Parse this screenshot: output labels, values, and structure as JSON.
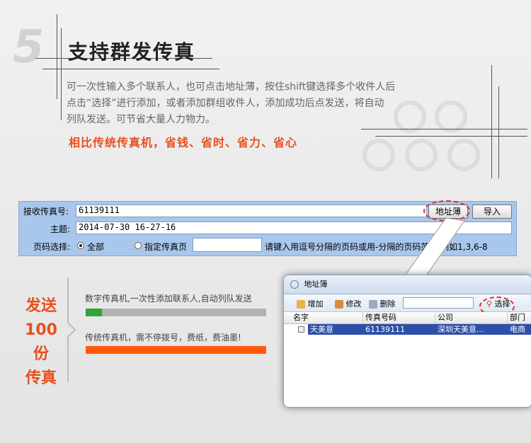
{
  "header": {
    "step_number": "5",
    "title": "支持群发传真",
    "desc_line1": "可一次性输入多个联系人，也可点击地址薄，按住shift键选择多个收件人后",
    "desc_line2": "点击“选择”进行添加，或者添加群组收件人，添加成功后点发送，将自动",
    "desc_line3": "列队发送。可节省大量人力物力。",
    "slogan": "相比传统传真机，省钱、省时、省力、省心"
  },
  "fax_form": {
    "fax_number_label": "接收传真号:",
    "fax_number_value": "61139111",
    "address_book_button": "地址薄",
    "import_button": "导入",
    "subject_label": "主题:",
    "subject_value": "2014-07-30 16-27-16",
    "page_select_label": "页码选择:",
    "option_all": "全部",
    "option_specified": "指定传真页",
    "hint": "请键入用逗号分隔的页码或用-分隔的页码范围,例如1,3,6-8"
  },
  "comparison": {
    "send_line1": "发送",
    "send_line2": "100份",
    "send_line3": "传真",
    "digital_text": "数字传真机,一次性添加联系人,自动列队发送",
    "digital_progress": 0.09,
    "traditional_text": "传统传真机，需不停拨号，费纸，费油墨!",
    "traditional_progress": 1.0
  },
  "address_book": {
    "title": "地址簿",
    "add_button": "增加",
    "edit_button": "修改",
    "delete_button": "删除",
    "select_button": "选择",
    "search_value": "",
    "columns": [
      "名字",
      "传真号码",
      "公司",
      "部门"
    ],
    "rows": [
      {
        "name": "天美意",
        "fax": "61139111",
        "company": "深圳天美意...",
        "dept": "电商"
      }
    ]
  },
  "colors": {
    "accent": "#e8501c",
    "panel": "#a9c7ec",
    "progress_green": "#2ea53a",
    "progress_orange": "#ff5a0a",
    "selected_row": "#2d4fa8"
  }
}
